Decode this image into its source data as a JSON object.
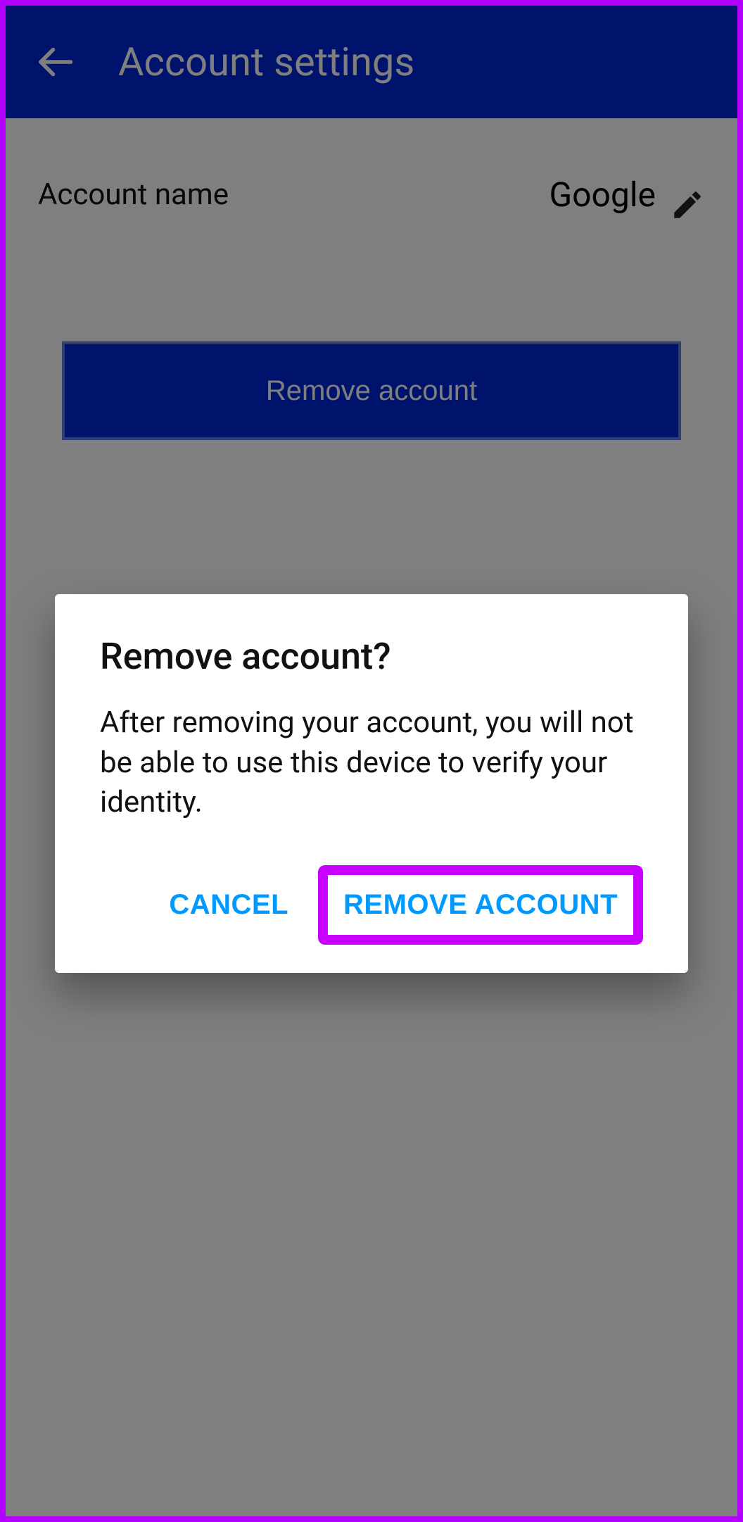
{
  "header": {
    "title": "Account settings"
  },
  "account": {
    "label": "Account name",
    "value": "Google"
  },
  "buttons": {
    "remove": "Remove account"
  },
  "dialog": {
    "title": "Remove account?",
    "body": "After removing your account, you will not be able to use this device to verify your identity.",
    "cancel": "CANCEL",
    "confirm": "REMOVE ACCOUNT"
  },
  "colors": {
    "primary": "#0026d8",
    "accent_text": "#0099ff",
    "highlight": "#c800ff"
  }
}
